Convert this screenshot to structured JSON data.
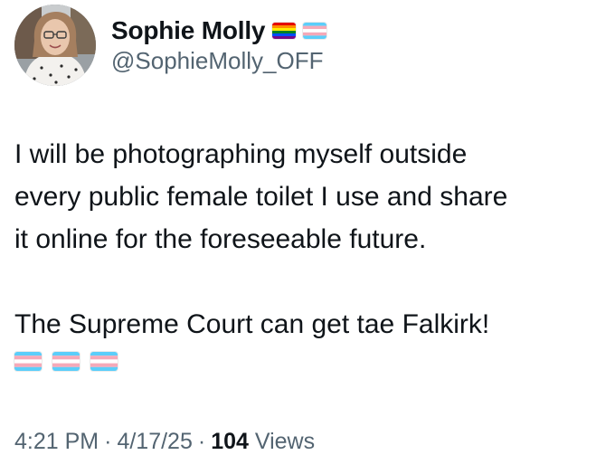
{
  "author": {
    "display_name": "Sophie Molly",
    "handle": "@SophieMolly_OFF",
    "name_flags": [
      "rainbow-flag-icon",
      "transgender-flag-icon"
    ]
  },
  "tweet": {
    "lines_paragraph_1": [
      "I will be photographing myself outside",
      "every public female toilet I use and share",
      "it online for the foreseeable future."
    ],
    "line_paragraph_2": "The Supreme Court can get tae Falkirk!",
    "trailing_emojis": [
      "transgender-flag-icon",
      "transgender-flag-icon",
      "transgender-flag-icon"
    ]
  },
  "meta": {
    "time": "4:21 PM",
    "separator": "·",
    "date": "4/17/25",
    "views_count": "104",
    "views_label": "Views"
  },
  "colors": {
    "text_primary": "#0f1419",
    "text_secondary": "#536471",
    "trans_blue": "#5BCEFA",
    "trans_pink": "#F5A9B8",
    "trans_white": "#FFFFFF"
  }
}
